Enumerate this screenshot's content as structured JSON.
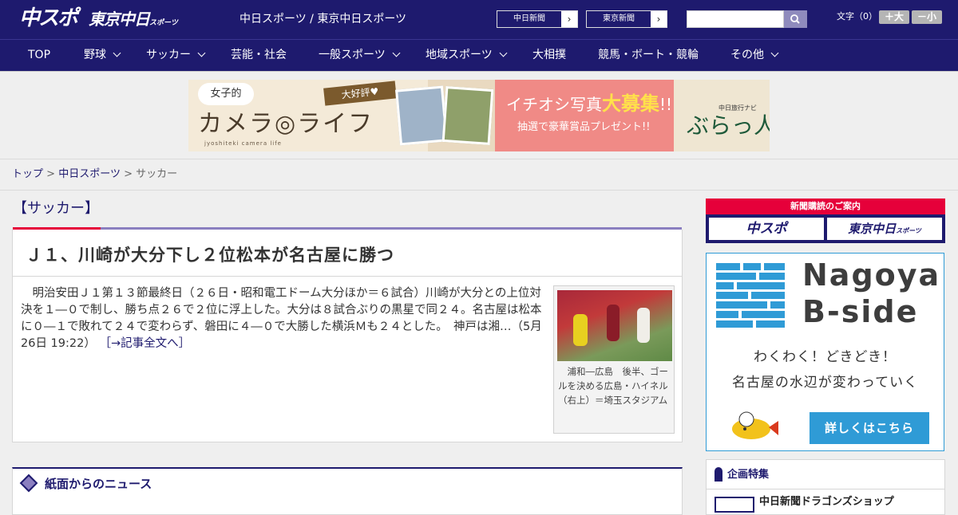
{
  "header": {
    "logo_chuspo": "中スポ",
    "logo_tokyo": "東京中日",
    "logo_tokyo_small": "スポーツ",
    "site_links": "中日スポーツ / 東京中日スポーツ",
    "btn_chunichi": "中日新聞",
    "btn_tokyo": "東京新聞",
    "arrow": "›",
    "search_placeholder": "",
    "font_label": "文字（0）",
    "font_plus": "＋大",
    "font_minus": "－小"
  },
  "nav": {
    "items": [
      {
        "label": "TOP",
        "dropdown": false
      },
      {
        "label": "野球",
        "dropdown": true
      },
      {
        "label": "サッカー",
        "dropdown": true
      },
      {
        "label": "芸能・社会",
        "dropdown": false
      },
      {
        "label": "一般スポーツ",
        "dropdown": true
      },
      {
        "label": "地域スポーツ",
        "dropdown": true
      },
      {
        "label": "大相撲",
        "dropdown": false
      },
      {
        "label": "競馬・ボート・競輪",
        "dropdown": false
      },
      {
        "label": "その他",
        "dropdown": true
      }
    ]
  },
  "banner": {
    "joshi": "女子的",
    "camera_life": "カメラ◎ライフ",
    "sub": "jyoshiteki camera life",
    "daikohyo": "大好評♥",
    "ichioshi_pre": "イチオシ写真",
    "ichioshi_big": "大募集",
    "ichioshi_post": "!!",
    "prize": "抽選で豪華賞品プレゼント!!",
    "navi": "中日旅行ナビ",
    "burattabi": "ぶらっ人"
  },
  "breadcrumb": {
    "home": "トップ",
    "sep": ">",
    "site": "中日スポーツ",
    "current": "サッカー"
  },
  "main": {
    "category": "【サッカー】",
    "headline": "Ｊ１、川崎が大分下し２位松本が名古屋に勝つ",
    "body": "　明治安田Ｊ１第１３節最終日（２６日・昭和電工ドーム大分ほか＝６試合）川崎が大分との上位対決を１―０で制し、勝ち点２６で２位に浮上した。大分は８試合ぶりの黒星で同２４。名古屋は松本に０―１で敗れて２４で変わらず、磐田に４―０で大勝した横浜Ｍも２４とした。　神戸は湘…（5月26日 19:22）",
    "more_link": "［→記事全文へ］",
    "photo_caption": "　浦和―広島　後半、ゴールを決める広島・ハイネル（右上）＝埼玉スタジアム",
    "news_section": "紙面からのニュース"
  },
  "sidebar": {
    "subscribe_head": "新聞購読のご案内",
    "sub_logo1": "中スポ",
    "sub_logo2": "東京中日",
    "sub_logo2_small": "スポーツ",
    "bside_line1": "Nagoya",
    "bside_line2": "B-side",
    "bside_tag1": "わくわく！どきどき！",
    "bside_tag2": "名古屋の水辺が変わっていく",
    "bside_btn": "詳しくはこちら",
    "feature_title": "企画特集",
    "feature_item": "中日新聞ドラゴンズショップ"
  },
  "colors": {
    "brand_navy": "#1e1a6e",
    "accent_red": "#e6003a",
    "accent_purple": "#8b7fc0",
    "bside_blue": "#2f9bd6"
  }
}
